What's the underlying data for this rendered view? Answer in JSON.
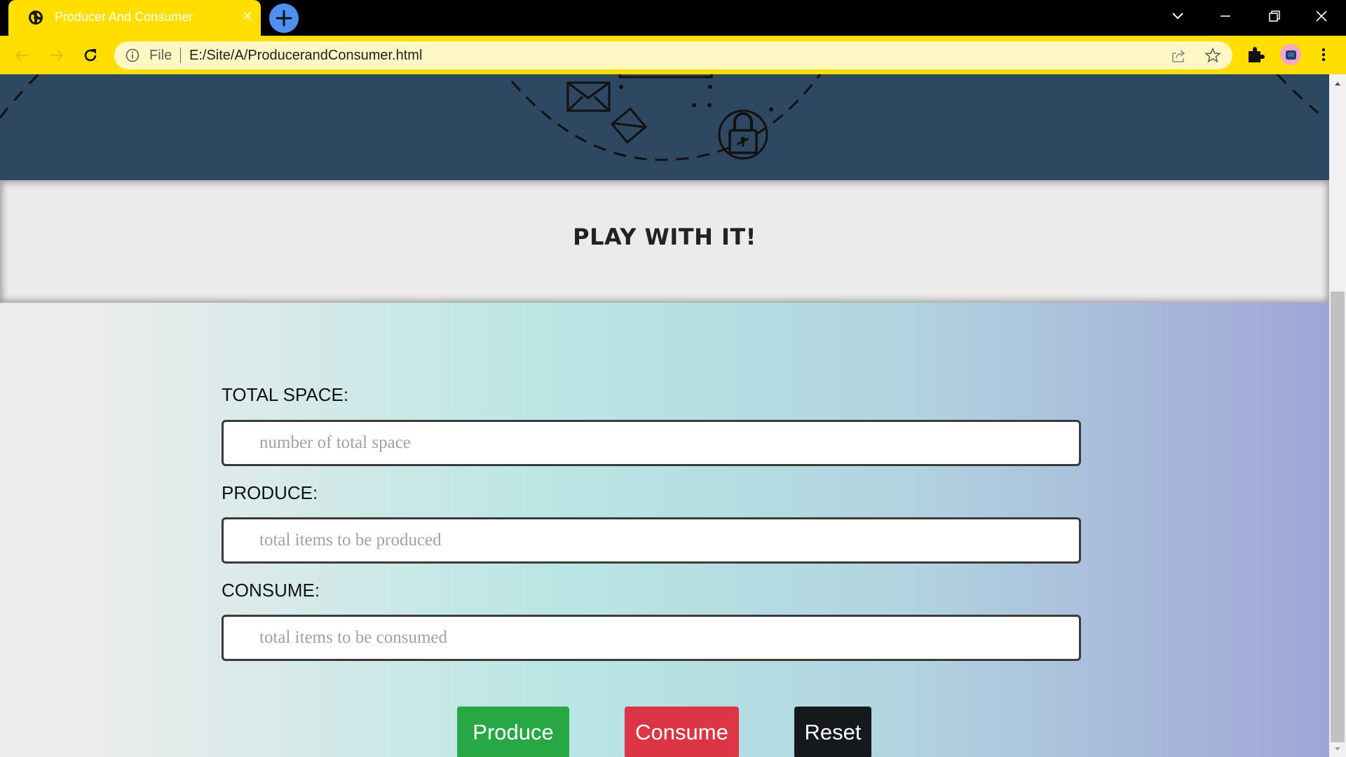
{
  "browser": {
    "tab_title": "Producer And Consumer",
    "address_scheme": "File",
    "address_url": "E:/Site/A/ProducerandConsumer.html"
  },
  "page": {
    "heading": "PLAY WITH IT!",
    "fields": [
      {
        "label": "TOTAL SPACE:",
        "placeholder": "number of total space",
        "value": ""
      },
      {
        "label": "PRODUCE:",
        "placeholder": "total items to be produced",
        "value": ""
      },
      {
        "label": "CONSUME:",
        "placeholder": "total items to be consumed",
        "value": ""
      }
    ],
    "buttons": {
      "produce": "Produce",
      "consume": "Consume",
      "reset": "Reset"
    }
  },
  "colors": {
    "browser_theme": "#ffde00",
    "hero_background": "#2d4860",
    "produce_button": "#28a745",
    "consume_button": "#dc3545",
    "reset_button": "#16191c"
  },
  "scroll": {
    "thumb_position": "bottom"
  }
}
